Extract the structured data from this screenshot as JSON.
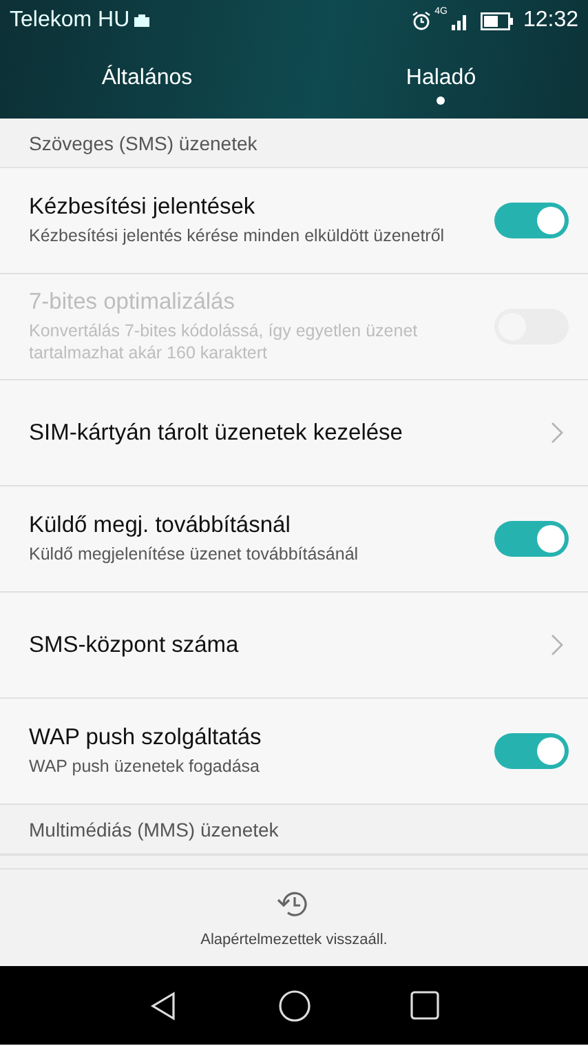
{
  "status_bar": {
    "carrier": "Telekom HU",
    "network": "4G",
    "time": "12:32"
  },
  "tabs": [
    {
      "label": "Általános",
      "selected": false
    },
    {
      "label": "Haladó",
      "selected": true
    }
  ],
  "sections": [
    {
      "title": "Szöveges (SMS) üzenetek",
      "items": [
        {
          "kind": "toggle",
          "title": "Kézbesítési jelentések",
          "subtitle": "Kézbesítési jelentés kérése minden elküldött üzenetről",
          "on": true,
          "disabled": false
        },
        {
          "kind": "toggle",
          "title": "7-bites optimalizálás",
          "subtitle": "Konvertálás 7-bites kódolássá, így egyetlen üzenet tartalmazhat akár 160 karaktert",
          "on": false,
          "disabled": true
        },
        {
          "kind": "link",
          "title": "SIM-kártyán tárolt üzenetek kezelése",
          "disabled": false
        },
        {
          "kind": "toggle",
          "title": "Küldő megj. továbbításnál",
          "subtitle": "Küldő megjelenítése üzenet továbbításánál",
          "on": true,
          "disabled": false
        },
        {
          "kind": "link",
          "title": "SMS-központ száma",
          "disabled": false
        },
        {
          "kind": "toggle",
          "title": "WAP push szolgáltatás",
          "subtitle": "WAP push üzenetek fogadása",
          "on": true,
          "disabled": false
        }
      ]
    },
    {
      "title": "Multimédiás (MMS) üzenetek"
    }
  ],
  "footer": {
    "label": "Alapértelmezettek visszaáll."
  }
}
